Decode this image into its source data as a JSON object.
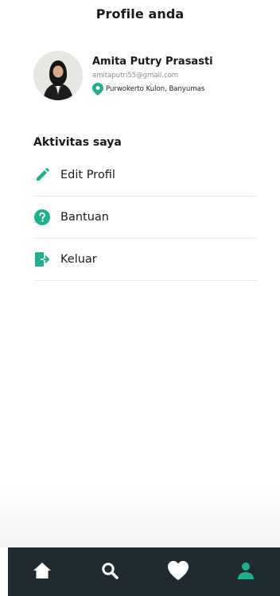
{
  "header": {
    "title": "Profile anda"
  },
  "profile": {
    "name": "Amita Putry Prasasti",
    "email": "amitaputri55@gmail.com",
    "location": "Purwokerto Kulon, Banyumas"
  },
  "section": {
    "title": "Aktivitas saya"
  },
  "menu": {
    "items": [
      {
        "label": "Edit Profil",
        "icon": "pencil-icon"
      },
      {
        "label": "Bantuan",
        "icon": "help-icon"
      },
      {
        "label": "Keluar",
        "icon": "logout-icon"
      }
    ]
  },
  "bottom_nav": {
    "items": [
      {
        "icon": "home-icon",
        "active": false
      },
      {
        "icon": "search-icon",
        "active": false
      },
      {
        "icon": "heart-icon",
        "active": false
      },
      {
        "icon": "user-icon",
        "active": true
      }
    ]
  },
  "colors": {
    "accent": "#1fae8e",
    "nav_background": "#1f2a31",
    "nav_icon": "#ffffff",
    "text": "#1a1a1a",
    "muted": "#8b8b8b"
  }
}
